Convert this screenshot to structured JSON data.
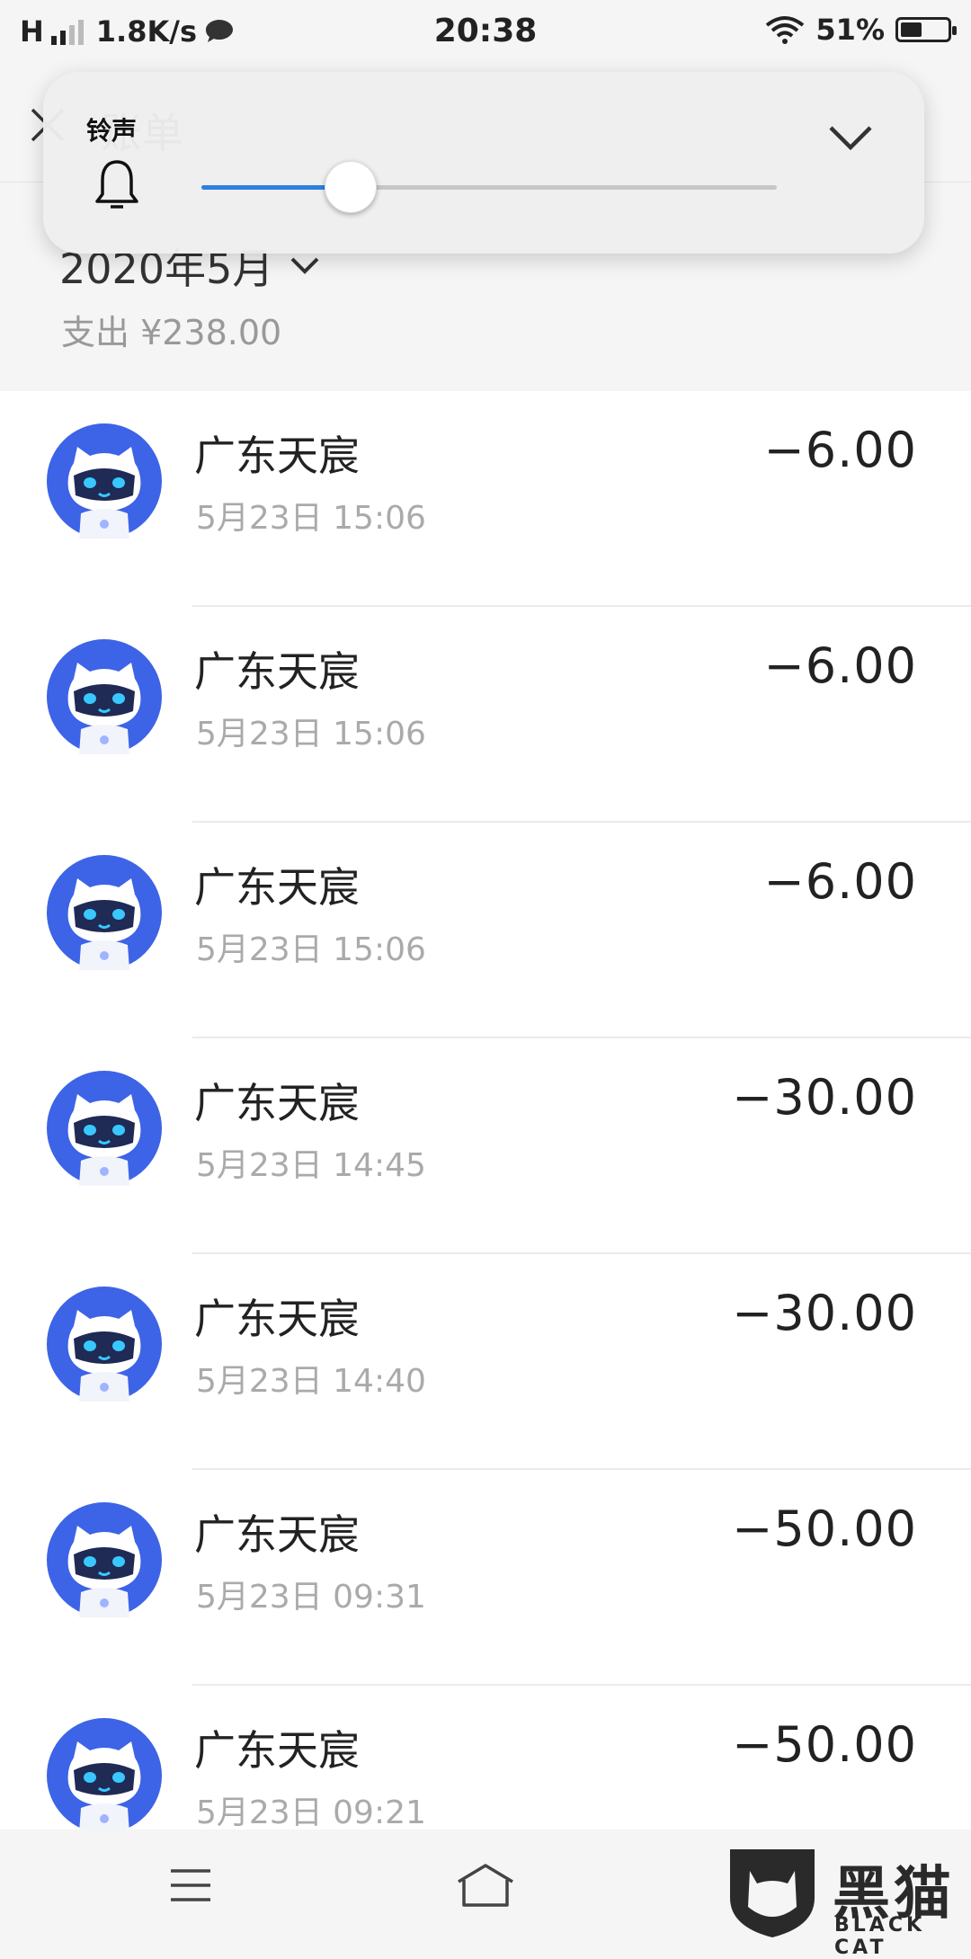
{
  "status_bar": {
    "network": "H",
    "speed": "1.8K/s",
    "time": "20:38",
    "battery": "51%",
    "battery_level": 0.51
  },
  "header": {
    "title": "账单"
  },
  "summary": {
    "month": "2020年5月",
    "spend": "支出 ¥238.00"
  },
  "volume_panel": {
    "label": "铃声",
    "level": 0.26,
    "accent": "#2e7fe0"
  },
  "transactions": [
    {
      "merchant": "广东天宸",
      "time": "5月23日 15:06",
      "amount": "−6.00"
    },
    {
      "merchant": "广东天宸",
      "time": "5月23日 15:06",
      "amount": "−6.00"
    },
    {
      "merchant": "广东天宸",
      "time": "5月23日 15:06",
      "amount": "−6.00"
    },
    {
      "merchant": "广东天宸",
      "time": "5月23日 14:45",
      "amount": "−30.00"
    },
    {
      "merchant": "广东天宸",
      "time": "5月23日 14:40",
      "amount": "−30.00"
    },
    {
      "merchant": "广东天宸",
      "time": "5月23日 09:31",
      "amount": "−50.00"
    },
    {
      "merchant": "广东天宸",
      "time": "5月23日 09:21",
      "amount": "−50.00"
    }
  ],
  "watermark": {
    "text": "黑猫",
    "sub": "BLACK CAT"
  },
  "colors": {
    "avatar_blue": "#3d63e6",
    "avatar_face": "#1f2a55",
    "avatar_eye": "#38c8ff"
  }
}
